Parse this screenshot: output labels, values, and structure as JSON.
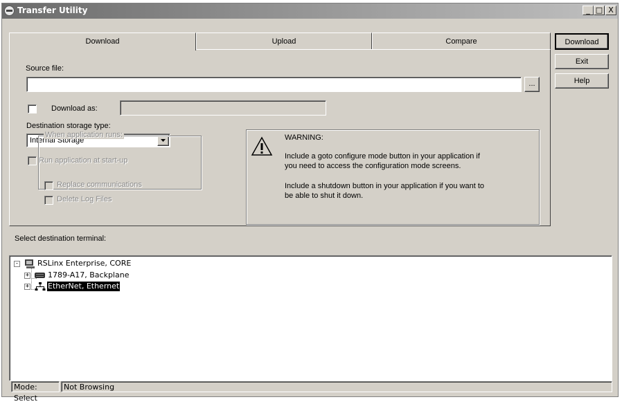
{
  "window": {
    "title": "Transfer Utility",
    "controls": [
      "_",
      "□",
      "X"
    ],
    "icon": "transfer-utility-app-icon"
  },
  "tabs": [
    {
      "label": "Download",
      "active": true
    },
    {
      "label": "Upload",
      "active": false
    },
    {
      "label": "Compare",
      "active": false
    }
  ],
  "side_buttons": {
    "download": "Download",
    "exit": "Exit",
    "help": "Help"
  },
  "download_tab": {
    "source_file_label": "Source file:",
    "source_file_value": "",
    "browse_label": "...",
    "download_as_label": "Download as:",
    "download_as_checked": false,
    "download_as_value": "",
    "dest_storage_label": "Destination storage type:",
    "dest_storage_value": "Internal Storage",
    "run_at_startup_label": "Run application at start-up",
    "when_runs_legend": "When application runs:",
    "replace_comms_label": "Replace communications",
    "delete_logs_label": "Delete Log Files"
  },
  "warning": {
    "heading": "WARNING:",
    "para1_line1": "Include a goto configure mode button in your application if",
    "para1_line2": "you need to access the configuration mode screens.",
    "para2_line1": "Include a shutdown button in your application if you want to",
    "para2_line2": "be able to shut it down.",
    "icon": "warning-triangle-icon"
  },
  "terminal": {
    "label": "Select destination terminal:",
    "tree": [
      {
        "label": "RSLinx Enterprise, CORE",
        "icon": "computer-icon",
        "expander": "-",
        "level": 0
      },
      {
        "label": "1789-A17, Backplane",
        "icon": "backplane-icon",
        "expander": "+",
        "level": 1
      },
      {
        "label": "EtherNet, Ethernet",
        "icon": "network-icon",
        "expander": "+",
        "level": 1,
        "selected": true
      }
    ]
  },
  "statusbar": {
    "mode": "Mode: Select",
    "browse": "Not Browsing"
  }
}
